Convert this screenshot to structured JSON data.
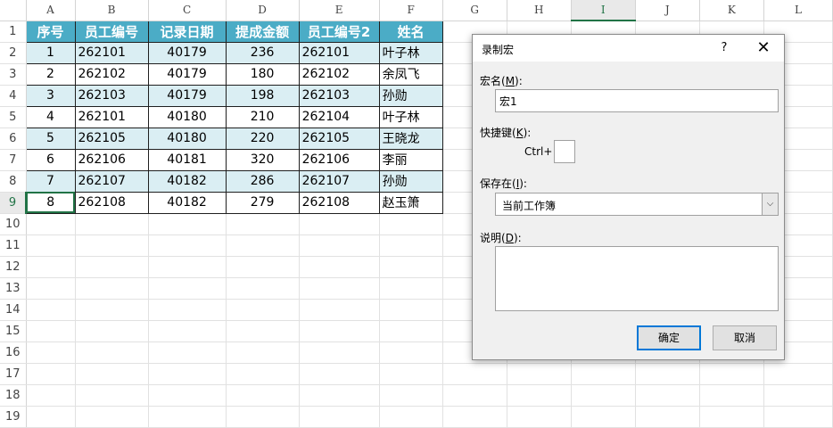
{
  "sheet": {
    "columns": [
      "A",
      "B",
      "C",
      "D",
      "E",
      "F",
      "G",
      "H",
      "I",
      "J",
      "K",
      "L"
    ],
    "row_numbers": [
      "1",
      "2",
      "3",
      "4",
      "5",
      "6",
      "7",
      "8",
      "9",
      "10",
      "11",
      "12",
      "13",
      "14",
      "15",
      "16",
      "17",
      "18",
      "19"
    ],
    "headers": [
      "序号",
      "员工编号",
      "记录日期",
      "提成金额",
      "员工编号2",
      "姓名"
    ],
    "rows": [
      [
        "1",
        "262101",
        "40179",
        "236",
        "262101",
        "叶子林"
      ],
      [
        "2",
        "262102",
        "40179",
        "180",
        "262102",
        "余凤飞"
      ],
      [
        "3",
        "262103",
        "40179",
        "198",
        "262103",
        "孙勋"
      ],
      [
        "4",
        "262101",
        "40180",
        "210",
        "262104",
        "叶子林"
      ],
      [
        "5",
        "262105",
        "40180",
        "220",
        "262105",
        "王晓龙"
      ],
      [
        "6",
        "262106",
        "40181",
        "320",
        "262106",
        "李丽"
      ],
      [
        "7",
        "262107",
        "40182",
        "286",
        "262107",
        "孙勋"
      ],
      [
        "8",
        "262108",
        "40182",
        "279",
        "262108",
        "赵玉箫"
      ]
    ],
    "colors": {
      "header_fill": "#4bacc6",
      "band_fill": "#daeef3",
      "selection": "#217346"
    }
  },
  "dialog": {
    "title": "录制宏",
    "help": "?",
    "close": "✕",
    "macro_name_label": {
      "pre": "宏名(",
      "key": "M",
      "post": "):"
    },
    "macro_name_value": "宏1",
    "shortcut_label": {
      "pre": "快捷键(",
      "key": "K",
      "post": "):"
    },
    "shortcut_prefix": "Ctrl+",
    "shortcut_value": "",
    "store_in_label": {
      "pre": "保存在(",
      "key": "I",
      "post": "):"
    },
    "store_in_value": "当前工作簿",
    "store_in_dropdown_icon": "chevron-down-icon",
    "description_label": {
      "pre": "说明(",
      "key": "D",
      "post": "):"
    },
    "description_value": "",
    "ok_label": "确定",
    "cancel_label": "取消"
  }
}
